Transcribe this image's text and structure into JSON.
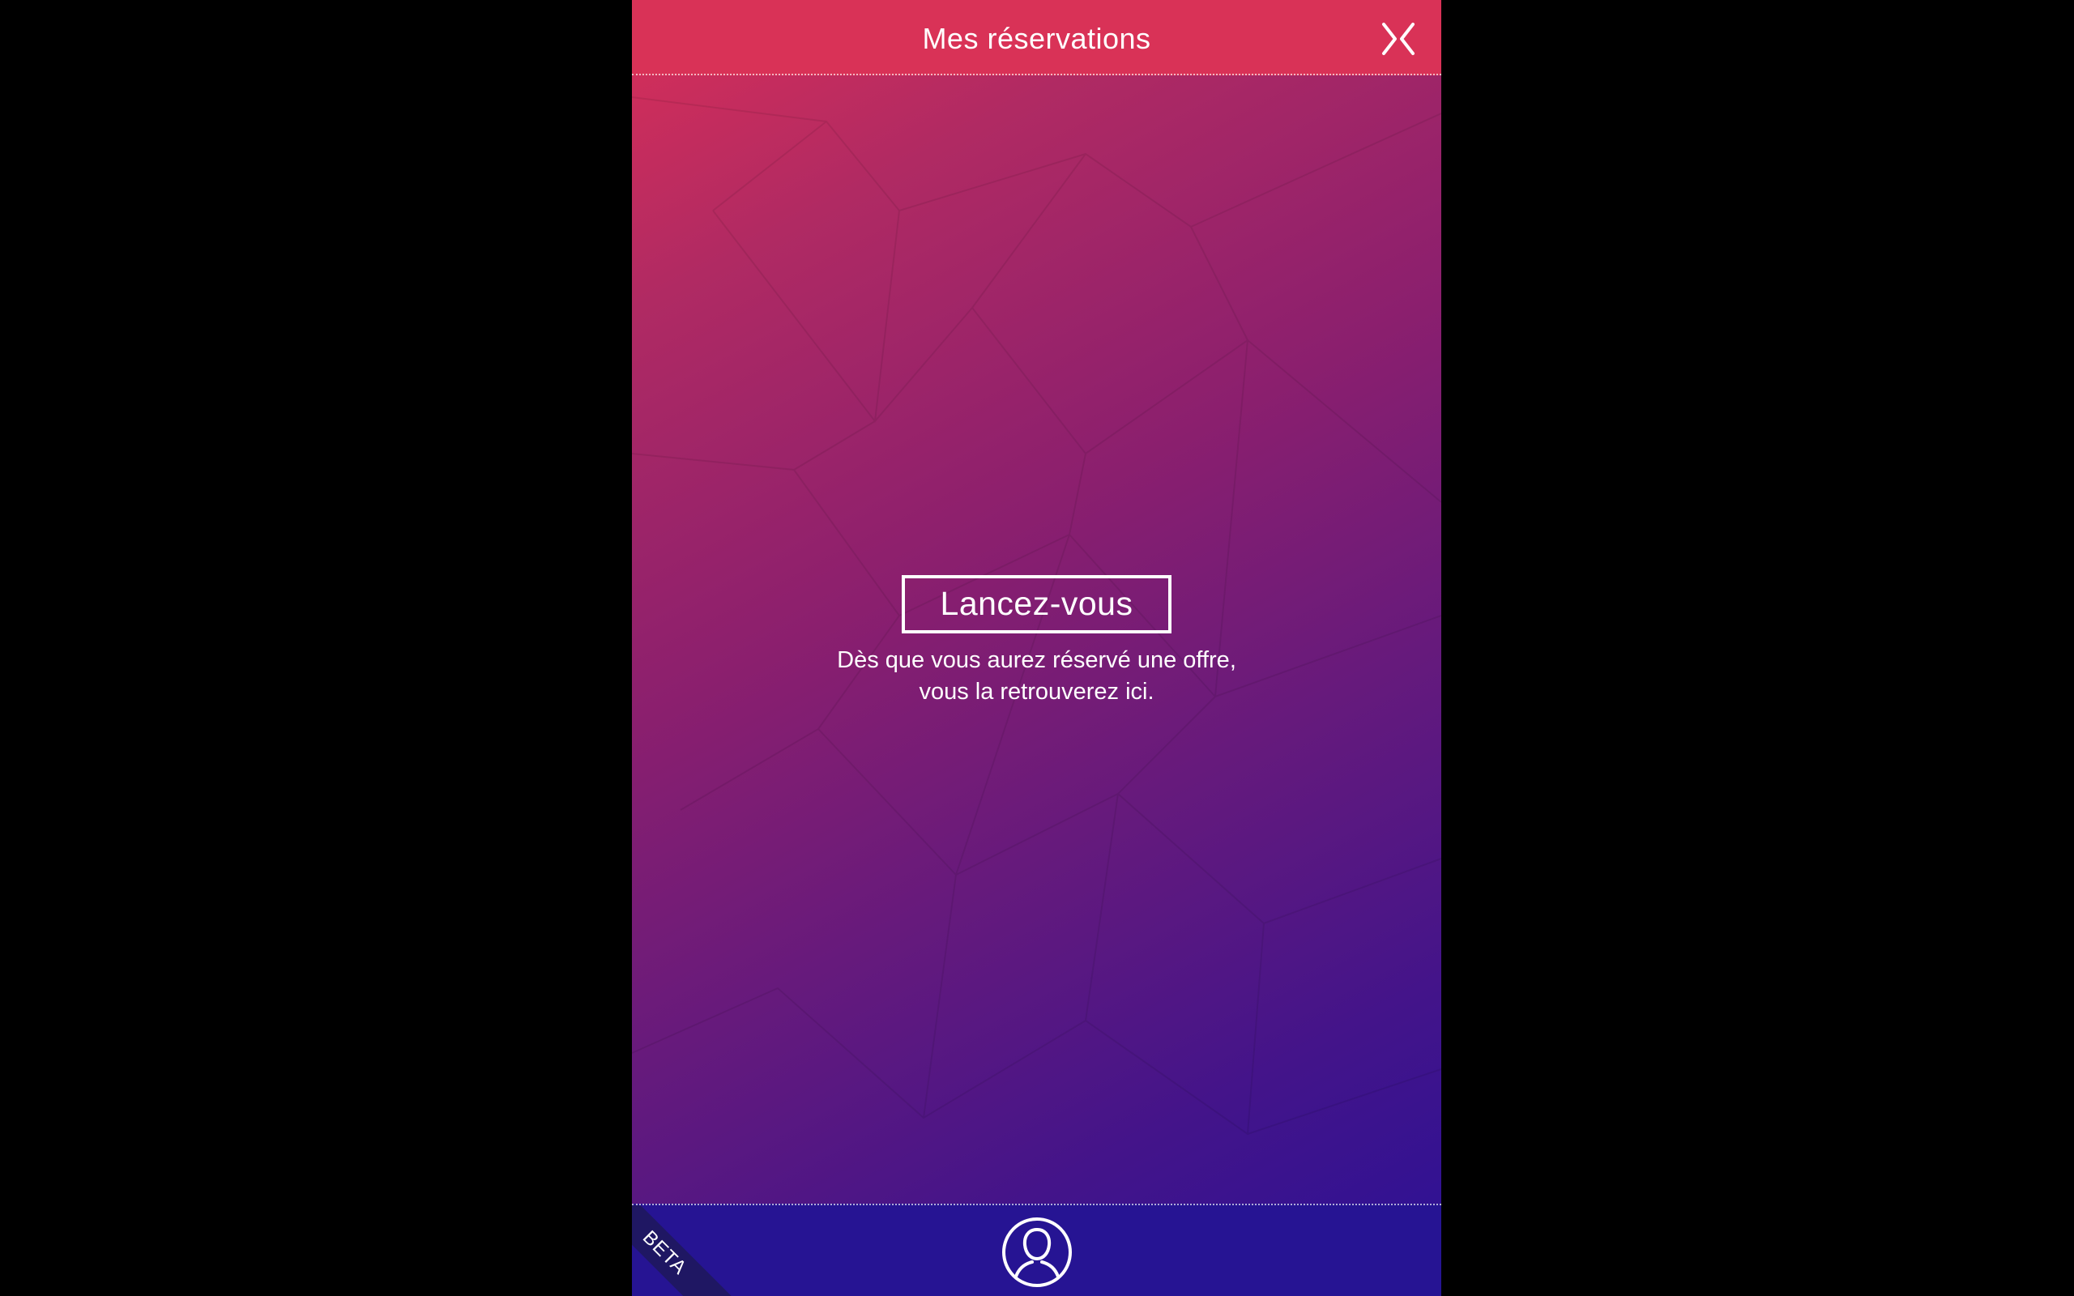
{
  "header": {
    "title": "Mes réservations",
    "close_icon": "close-chevrons-icon"
  },
  "empty_state": {
    "cta_label": "Lancez-vous",
    "hint_line1": "Dès que vous aurez réservé une offre,",
    "hint_line2": "vous la retrouverez ici."
  },
  "footer": {
    "profile_icon": "user-profile-icon",
    "badge": "BETA"
  },
  "colors": {
    "header_bg": "#d93257",
    "footer_bg": "#261493",
    "gradient_start": "#d92f58",
    "gradient_end": "#2a1196",
    "text": "#ffffff"
  }
}
